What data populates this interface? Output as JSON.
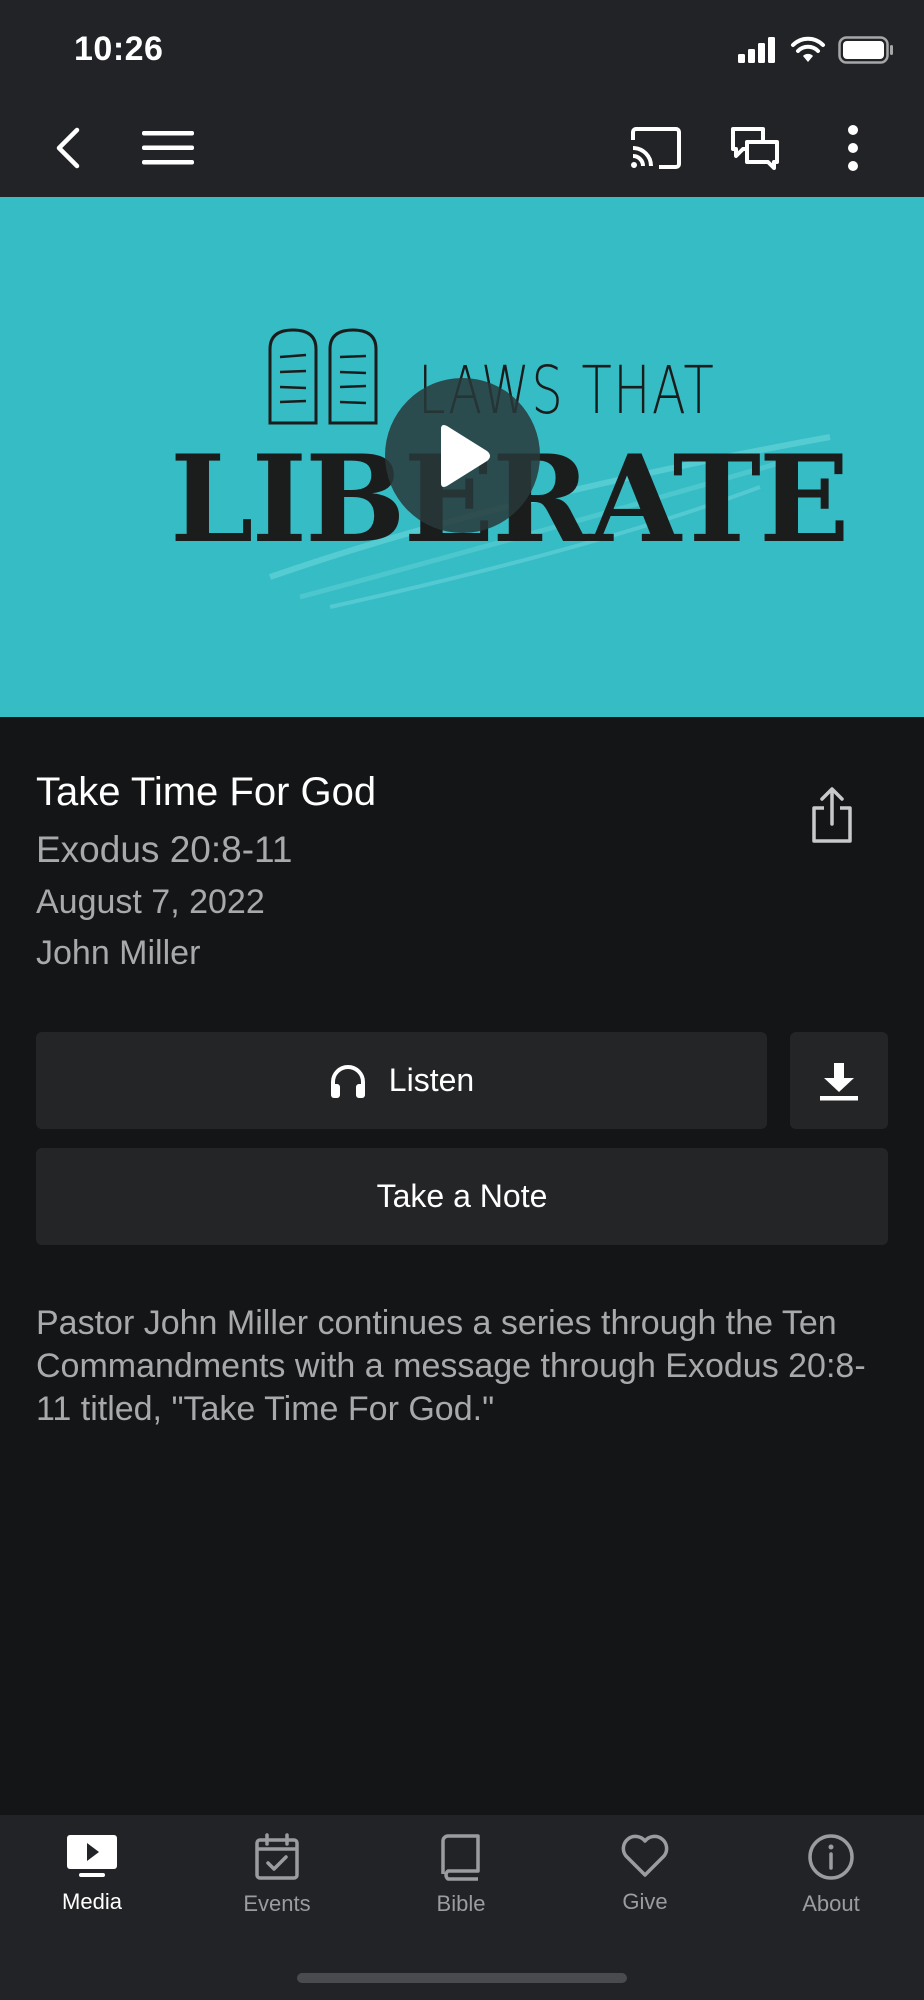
{
  "status_bar": {
    "time": "10:26"
  },
  "hero": {
    "small_text": "LAWS THAT",
    "big_text": "LIBERATE"
  },
  "sermon": {
    "title": "Take Time For God",
    "scripture": "Exodus 20:8-11",
    "date": "August 7, 2022",
    "speaker": "John Miller",
    "description": "Pastor John Miller continues a series through the Ten Commandments with a message through Exodus 20:8-11 titled, \"Take Time For God.\""
  },
  "actions": {
    "listen_label": "Listen",
    "note_label": "Take a Note"
  },
  "tabs": [
    {
      "label": "Media",
      "icon": "media-icon",
      "active": true
    },
    {
      "label": "Events",
      "icon": "calendar-icon",
      "active": false
    },
    {
      "label": "Bible",
      "icon": "book-icon",
      "active": false
    },
    {
      "label": "Give",
      "icon": "heart-icon",
      "active": false
    },
    {
      "label": "About",
      "icon": "info-icon",
      "active": false
    }
  ],
  "colors": {
    "hero_background": "#36bcc4",
    "app_background": "#141517",
    "bar_background": "#222326",
    "secondary_text": "#a7a9ab"
  }
}
